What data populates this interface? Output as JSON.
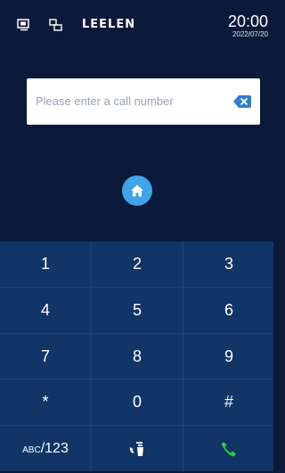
{
  "statusbar": {
    "brand": "LEELEN",
    "time": "20:00",
    "date": "2022/07/20",
    "icons": [
      "indoor-monitor-icon",
      "linked-devices-icon"
    ]
  },
  "dialer": {
    "input_placeholder": "Please enter a call number",
    "input_value": "",
    "backspace_icon": "backspace-icon",
    "home_icon": "home-icon"
  },
  "keypad": {
    "keys": [
      "1",
      "2",
      "3",
      "4",
      "5",
      "6",
      "7",
      "8",
      "9",
      "*",
      "0",
      "#"
    ],
    "mode_prefix": "ABC",
    "mode_suffix": "/123",
    "contacts_icon": "call-management-icon",
    "call_icon": "phone-call-icon"
  },
  "colors": {
    "background": "#0b1a3a",
    "keypad_background": "#113566",
    "accent_blue": "#3fa4e8",
    "call_green": "#2ecc40"
  }
}
